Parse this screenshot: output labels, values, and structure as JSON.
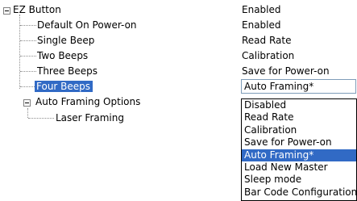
{
  "tree": {
    "root": {
      "label": "EZ Button",
      "value": "Enabled"
    },
    "children": [
      {
        "label": "Default On Power-on",
        "value": "Enabled"
      },
      {
        "label": "Single Beep",
        "value": "Read Rate"
      },
      {
        "label": "Two Beeps",
        "value": "Calibration"
      },
      {
        "label": "Three Beeps",
        "value": "Save for Power-on"
      },
      {
        "label": "Four Beeps",
        "value": "Auto Framing*"
      }
    ],
    "group": {
      "label": "Auto Framing Options"
    },
    "leaf": {
      "label": "Laser Framing"
    }
  },
  "dropdown": {
    "current": "Auto Framing*",
    "options": [
      "Disabled",
      "Read Rate",
      "Calibration",
      "Save for Power-on",
      "Auto Framing*",
      "Load New Master",
      "Sleep mode",
      "Bar Code Configuration"
    ],
    "selected_index": 4
  },
  "colors": {
    "selection": "#316ac5",
    "tree_line": "#8c8c8c"
  }
}
